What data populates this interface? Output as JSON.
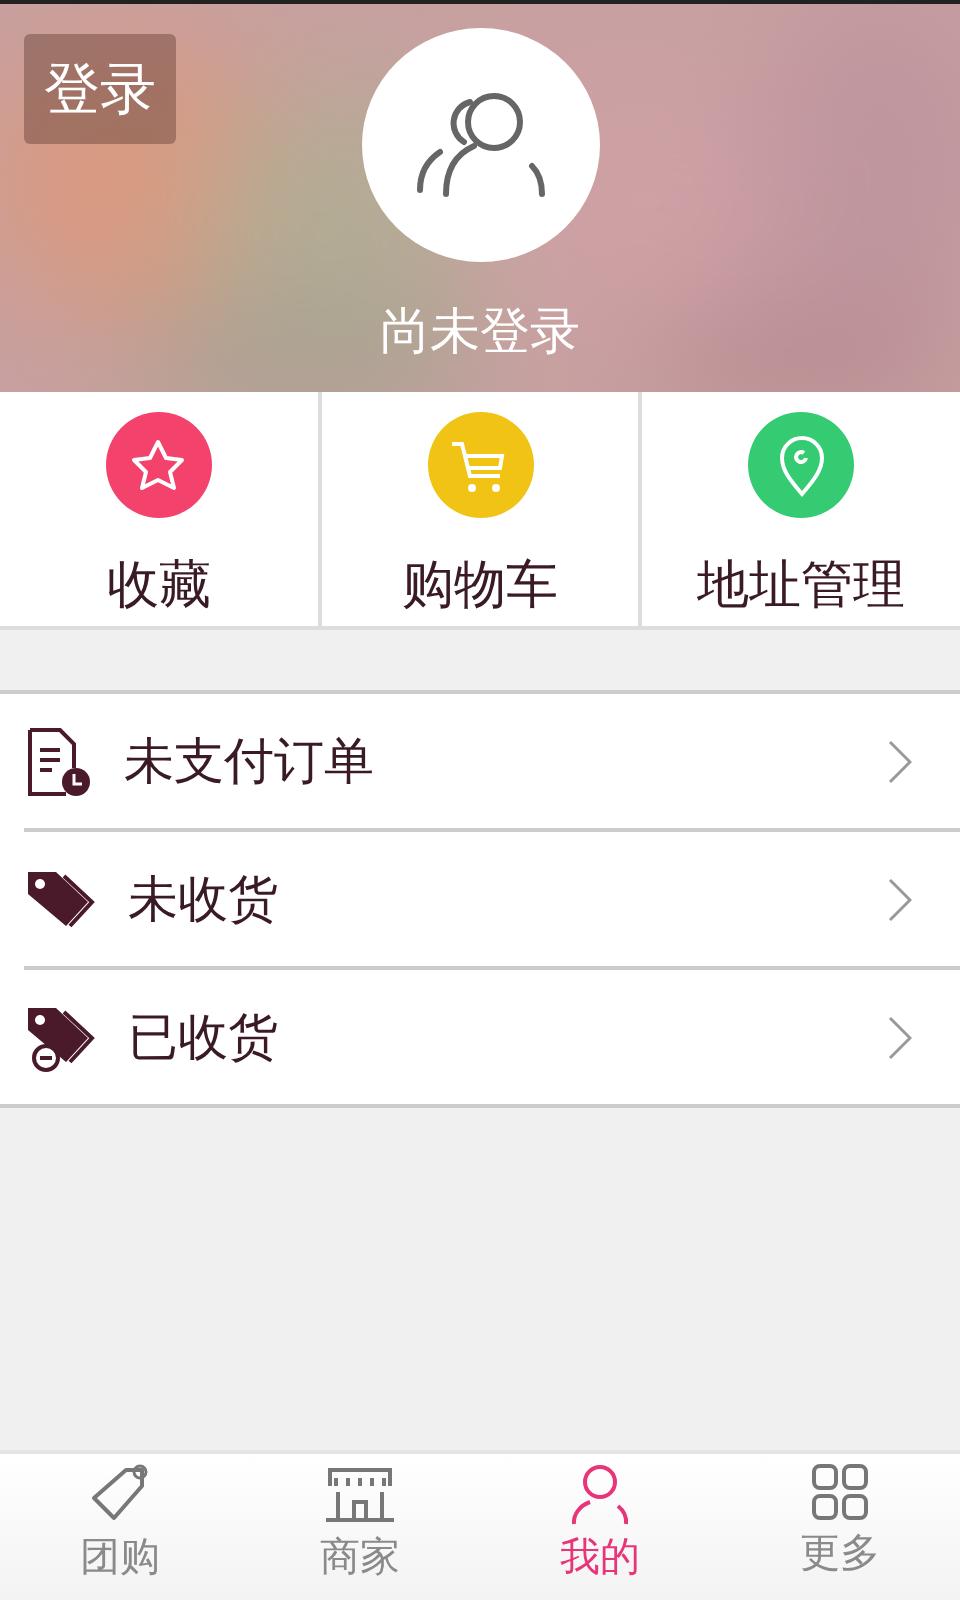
{
  "header": {
    "login_button": "登录",
    "status": "尚未登录"
  },
  "quick_actions": [
    {
      "kind": "star",
      "label": "收藏",
      "color": "#f3436c"
    },
    {
      "kind": "cart",
      "label": "购物车",
      "color": "#f0c315"
    },
    {
      "kind": "pin",
      "label": "地址管理",
      "color": "#35cb72"
    }
  ],
  "orders": [
    {
      "kind": "document",
      "label": "未支付订单"
    },
    {
      "kind": "tag",
      "label": "未收货"
    },
    {
      "kind": "tag-minus",
      "label": "已收货"
    }
  ],
  "tabs": [
    {
      "kind": "tag",
      "label": "团购",
      "selected": false
    },
    {
      "kind": "shop",
      "label": "商家",
      "selected": false
    },
    {
      "kind": "person",
      "label": "我的",
      "selected": true
    },
    {
      "kind": "grid",
      "label": "更多",
      "selected": false
    }
  ]
}
